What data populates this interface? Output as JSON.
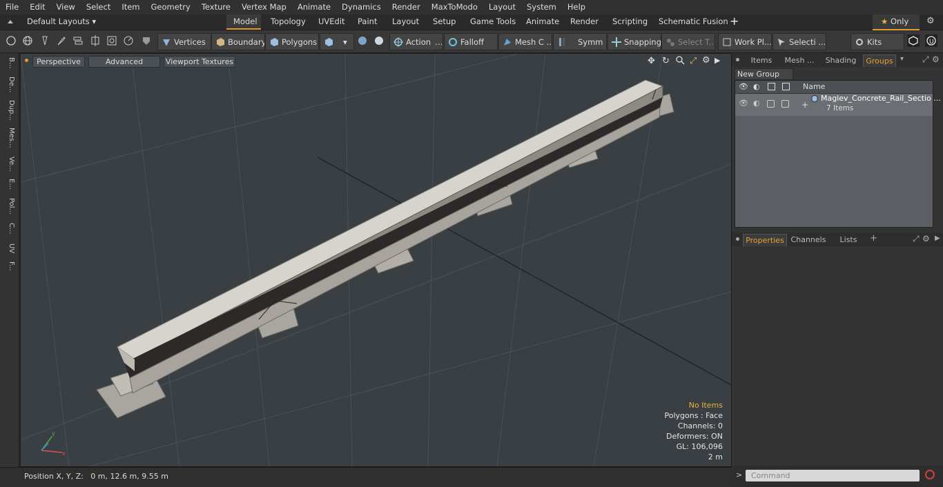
{
  "menu": [
    "File",
    "Edit",
    "View",
    "Select",
    "Item",
    "Geometry",
    "Texture",
    "Vertex Map",
    "Animate",
    "Dynamics",
    "Render",
    "MaxToModo",
    "Layout",
    "System",
    "Help"
  ],
  "layout_dropdown": "Default Layouts",
  "layout_tabs": [
    "Model",
    "Topology",
    "UVEdit",
    "Paint",
    "Layout",
    "Setup",
    "Game Tools",
    "Animate",
    "Render",
    "Scripting",
    "Schematic Fusion"
  ],
  "active_layout_tab": "Model",
  "only_label": "Only",
  "toolbar": {
    "vertices": "Vertices",
    "boundary": "Boundary",
    "polygons": "Polygons",
    "action": "Action",
    "falloff": "Falloff",
    "mesh_c": "Mesh C ...",
    "symm": "Symm ...",
    "snapping": "Snapping",
    "select_t": "Select T...",
    "work_pl": "Work Pl...",
    "selecti": "Selecti ...",
    "kits": "Kits"
  },
  "left_tabs": [
    "B...",
    "De...",
    "Dup...",
    "Mes...",
    "Ve...",
    "E...",
    "Pol...",
    "C...",
    "UV",
    "F..."
  ],
  "viewport": {
    "perspective": "Perspective",
    "advanced": "Advanced",
    "viewport_textures": "Viewport Textures",
    "info": {
      "no_items": "No Items",
      "polygons": "Polygons : Face",
      "channels": "Channels: 0",
      "deformers": "Deformers: ON",
      "gl": "GL: 106,096",
      "scale": "2 m"
    }
  },
  "status": {
    "position": "Position X, Y, Z:   0 m, 12.6 m, 9.55 m"
  },
  "right_panel": {
    "tabs": [
      "Items",
      "Mesh ...",
      "Shading",
      "Groups"
    ],
    "active_tab": "Groups",
    "new_group": "New Group",
    "name_header": "Name",
    "group_name": "Maglev_Concrete_Rail_Sectio ...",
    "group_count": "7 Items",
    "bottom_tabs": [
      "Properties",
      "Channels",
      "Lists"
    ],
    "bottom_active": "Properties",
    "command_placeholder": "Command"
  },
  "colors": {
    "accent": "#e19a2b",
    "viewport_bg": "#3a3f44",
    "warn": "#e8b341"
  }
}
